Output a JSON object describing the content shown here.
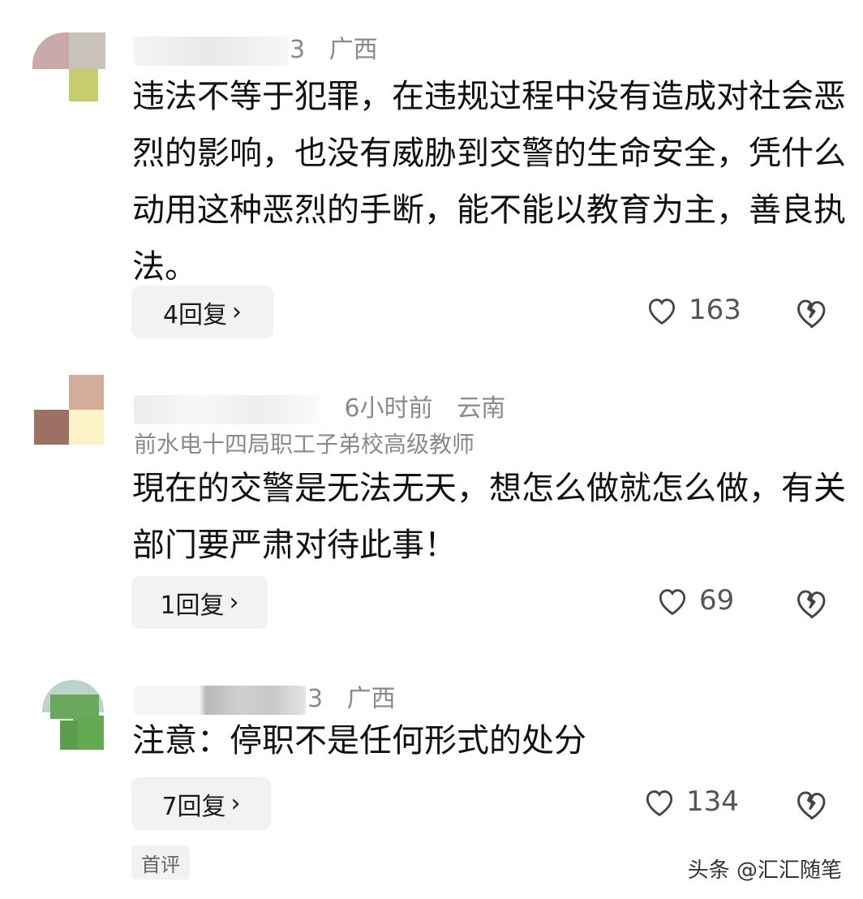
{
  "comments": [
    {
      "name_suffix": "3",
      "location": "广西",
      "text": "违法不等于犯罪，在违规过程中没有造成对社会恶烈的影响，也没有威胁到交警的生命安全，凭什么动用这种恶烈的手断，能不能以教育为主，善良执法。",
      "reply_label": "4回复",
      "likes": "163"
    },
    {
      "name_suffix": "",
      "time": "6小时前",
      "location": "云南",
      "subtitle": "前水电十四局职工子弟校高级教师",
      "text": "現在的交警是无法无天，想怎么做就怎么做，有关部门要严肃对待此事！",
      "reply_label": "1回复",
      "likes": "69"
    },
    {
      "name_suffix": "3",
      "location": "广西",
      "text": "注意：停职不是任何形式的处分",
      "reply_label": "7回复",
      "likes": "134"
    }
  ],
  "first_comment_tag": "首评",
  "watermark": "头条 @汇汇随笔",
  "icons": {
    "like": "heart-outline-icon",
    "dislike": "broken-heart-icon",
    "chevron": "chevron-right-icon"
  }
}
